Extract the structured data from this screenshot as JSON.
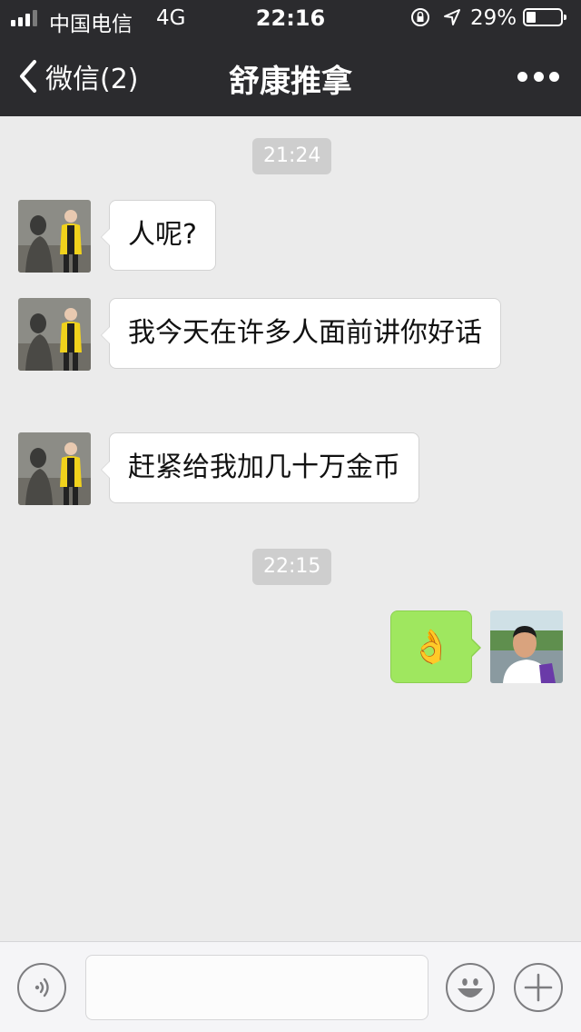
{
  "status_bar": {
    "carrier": "中国电信",
    "network": "4G",
    "time": "22:16",
    "battery": "29%",
    "battery_level": 0.29
  },
  "nav": {
    "back_label": "微信(2)",
    "title": "舒康推拿",
    "more_icon": "more-dots-icon"
  },
  "chat": {
    "timestamps": [
      "21:24",
      "22:15"
    ],
    "messages": [
      {
        "direction": "incoming",
        "text": "人呢?"
      },
      {
        "direction": "incoming",
        "text": "我今天在许多人面前讲你好话"
      },
      {
        "direction": "incoming",
        "text": "赶紧给我加几十万金币"
      },
      {
        "direction": "outgoing",
        "emoji": "👌"
      }
    ]
  },
  "input_bar": {
    "voice_icon": "voice-icon",
    "message_value": "",
    "emoji_icon": "emoji-icon",
    "plus_icon": "plus-icon"
  },
  "colors": {
    "header_bg": "#2b2b2e",
    "chat_bg": "#ebebeb",
    "outgoing_bubble": "#9fe75f",
    "incoming_bubble": "#ffffff"
  }
}
